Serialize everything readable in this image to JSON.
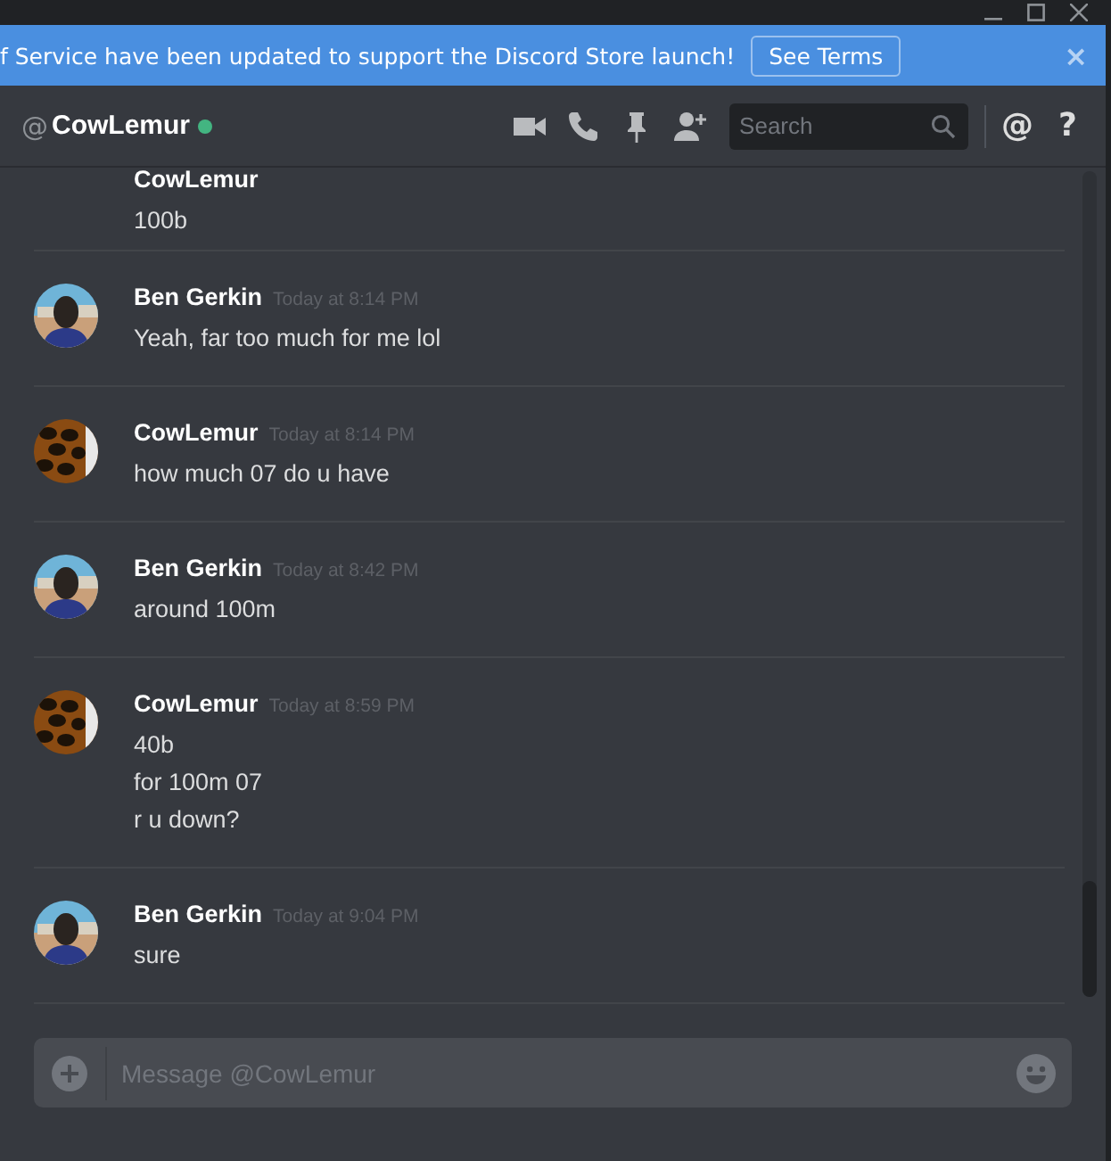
{
  "banner": {
    "text": "f Service have been updated to support the Discord Store launch!",
    "button": "See Terms",
    "close": "×"
  },
  "header": {
    "at": "@",
    "name": "CowLemur",
    "online": true,
    "search": {
      "placeholder": "Search"
    },
    "mention_symbol": "@",
    "help_symbol": "?"
  },
  "messages": [
    {
      "author": "CowLemur",
      "lines": [
        "100b"
      ]
    },
    {
      "author": "Ben Gerkin",
      "time": "Today at 8:14 PM",
      "lines": [
        "Yeah, far too much for me lol"
      ]
    },
    {
      "author": "CowLemur",
      "time": "Today at 8:14 PM",
      "lines": [
        "how much 07 do u have"
      ]
    },
    {
      "author": "Ben Gerkin",
      "time": "Today at 8:42 PM",
      "lines": [
        "around 100m"
      ]
    },
    {
      "author": "CowLemur",
      "time": "Today at 8:59 PM",
      "lines": [
        "40b",
        "for 100m 07",
        "r u down?"
      ]
    },
    {
      "author": "Ben Gerkin",
      "time": "Today at 9:04 PM",
      "lines": [
        "sure"
      ]
    }
  ],
  "composer": {
    "placeholder": "Message @CowLemur"
  }
}
